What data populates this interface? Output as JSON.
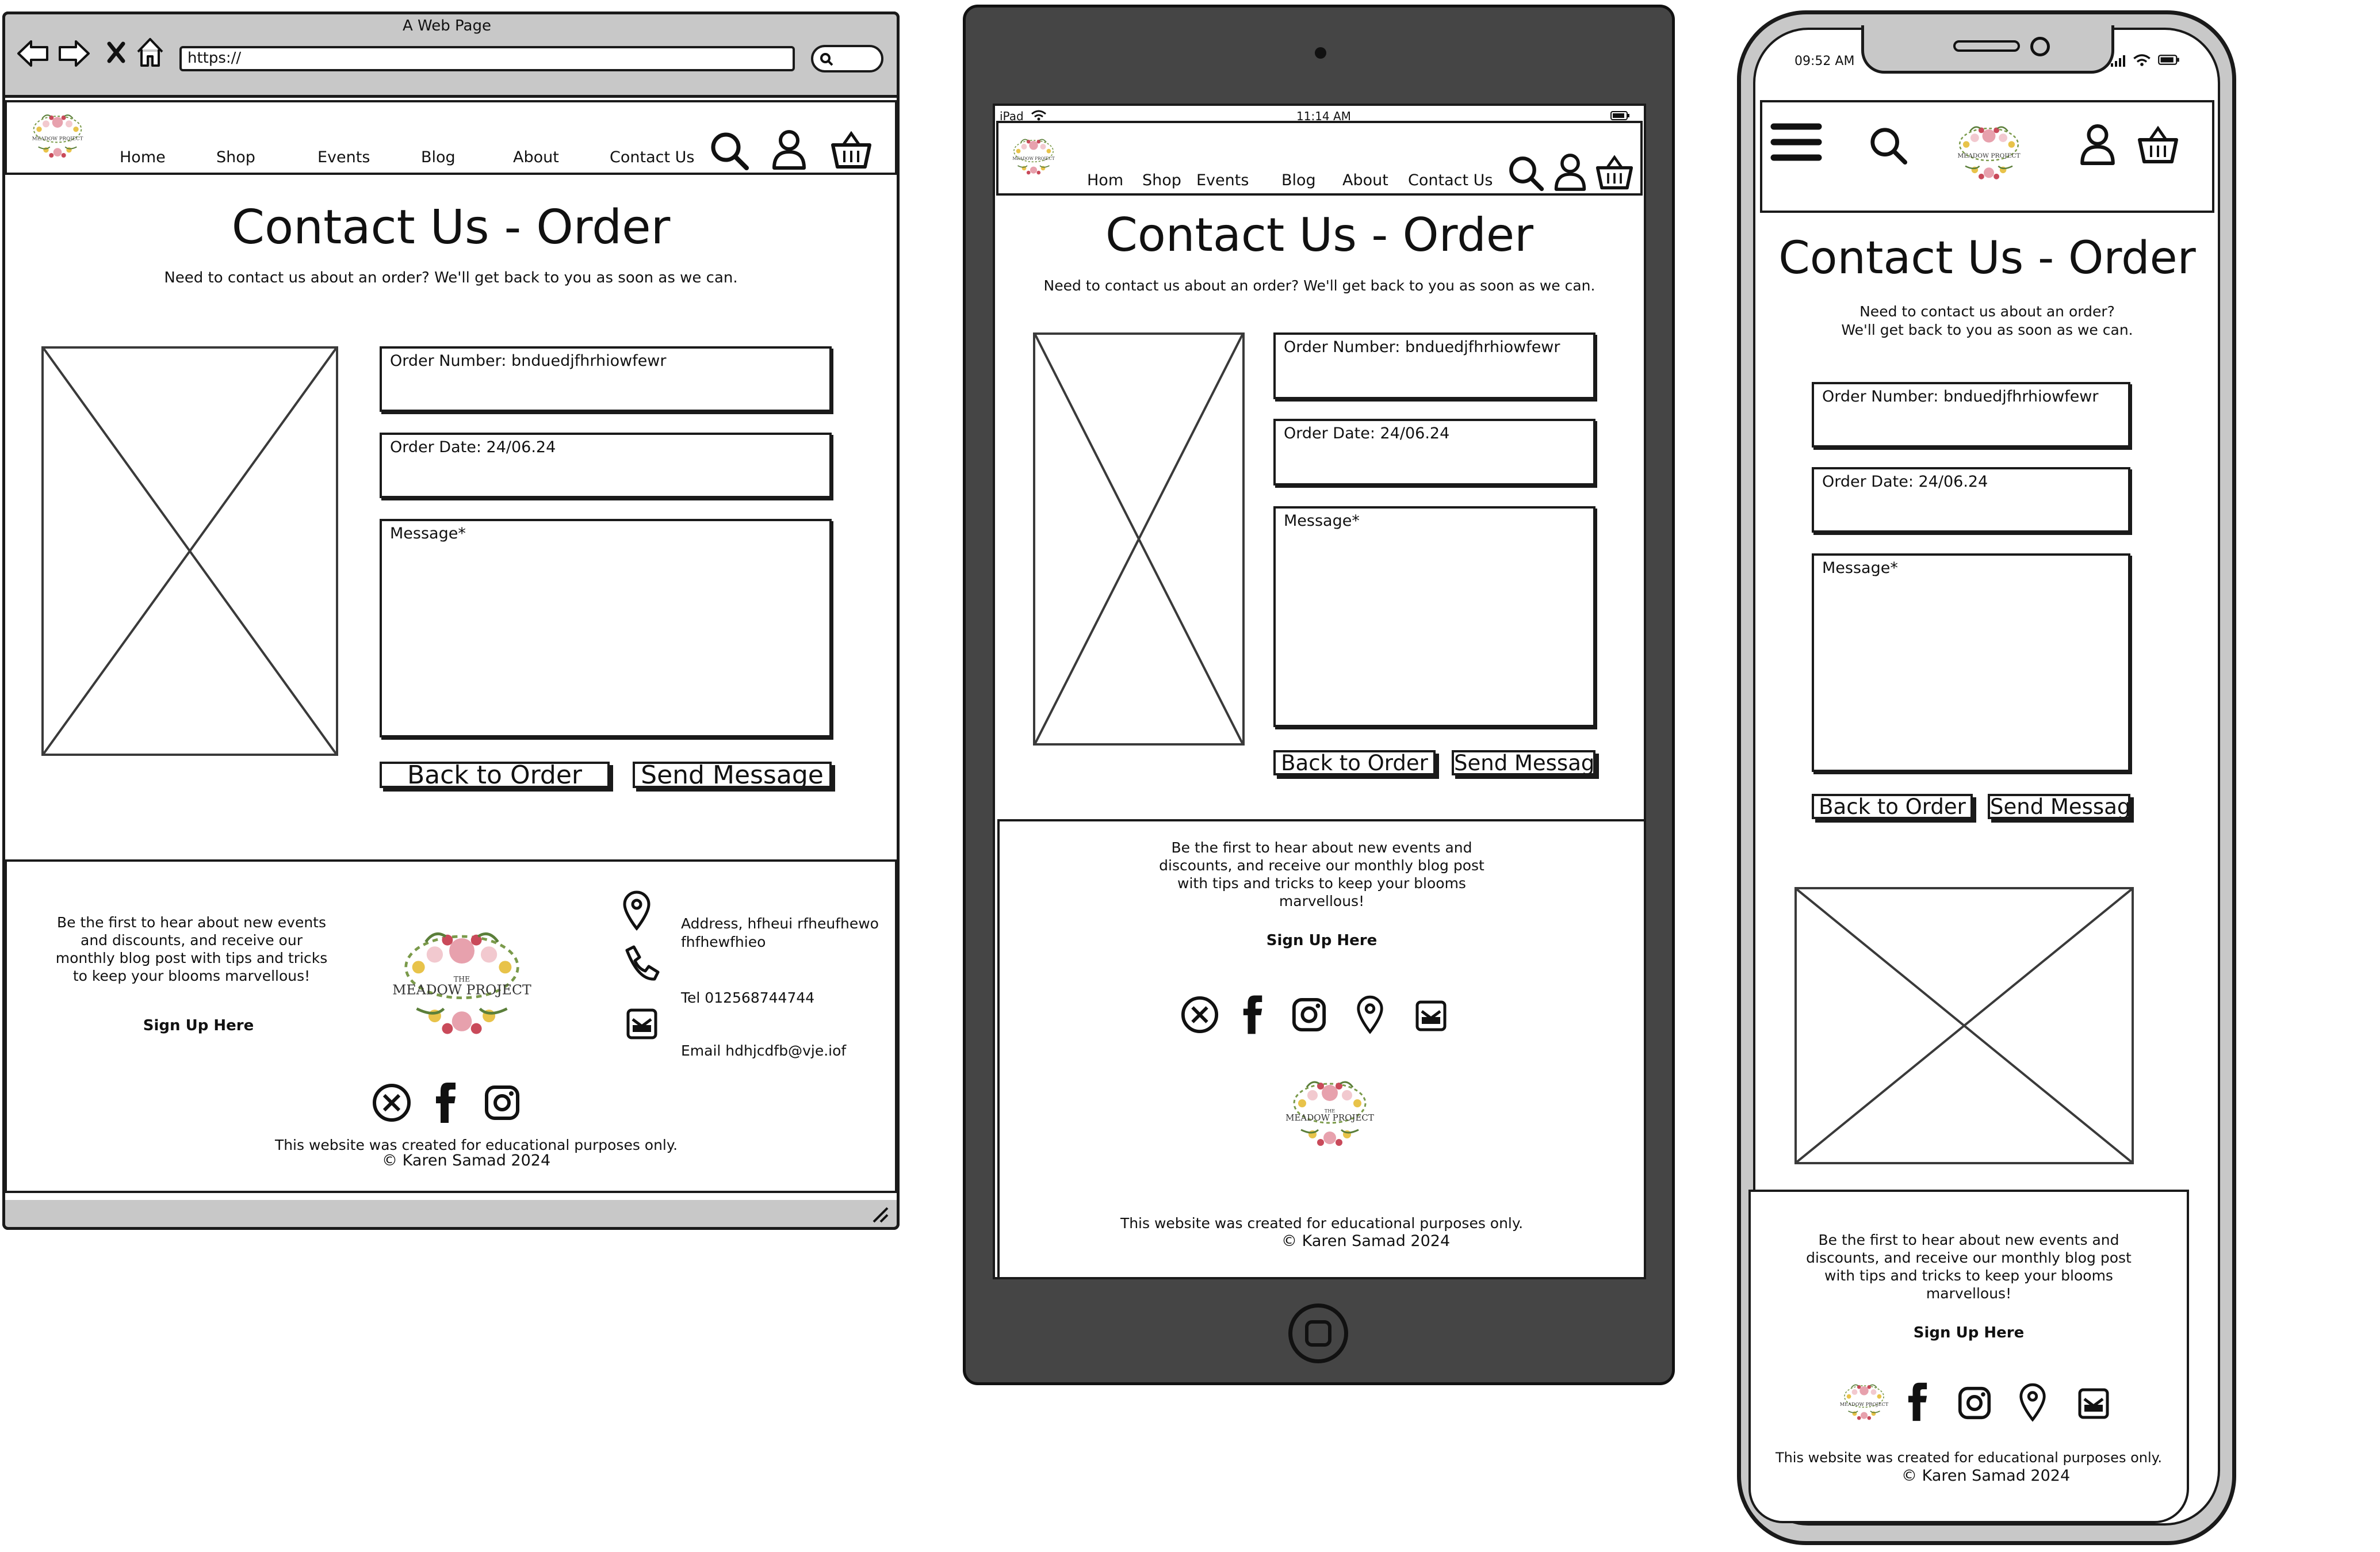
{
  "browser": {
    "window_title": "A Web Page",
    "address": "https://"
  },
  "ipad_status": {
    "device": "iPad",
    "time": "11:14 AM"
  },
  "phone_status": {
    "time": "09:52 AM"
  },
  "nav": {
    "home": "Home",
    "home_tablet": "Hom",
    "shop": "Shop",
    "events": "Events",
    "blog": "Blog",
    "about": "About",
    "contact": "Contact Us"
  },
  "page": {
    "title": "Contact Us - Order",
    "subtitle": "Need to contact us about an order? We'll get back to you as soon as we can.",
    "subtitle_mobile_line1": "Need to contact us about an order?",
    "subtitle_mobile_line2": "We'll get back to you as soon as we can."
  },
  "form": {
    "order_number": "Order Number: bnduedjfhrhiowfewr",
    "order_date": "Order Date: 24/06.24",
    "message": "Message*",
    "back_button": "Back to Order",
    "send_button": "Send Message",
    "send_button_small": "Send Messag"
  },
  "logo": {
    "line1": "THE",
    "line2": "MEADOW PROJECT"
  },
  "footer": {
    "newsletter_lines": [
      "Be the first to hear about new events",
      "and discounts, and receive our",
      "monthly blog post with tips and tricks",
      "to keep your blooms marvellous!"
    ],
    "newsletter_lines_narrow": [
      "Be the first to hear about new events and",
      "discounts, and receive our monthly blog post",
      "with tips and tricks to keep your blooms",
      "marvellous!"
    ],
    "signup": "Sign Up Here",
    "address_line1": "Address, hfheui rfheufhewo",
    "address_line2": "fhfhewfhieo",
    "tel": "Tel 012568744744",
    "email": "Email hdhjcdfb@vje.iof",
    "disclaimer": "This website was created for educational purposes only.",
    "copyright": "Karen Samad 2024"
  }
}
